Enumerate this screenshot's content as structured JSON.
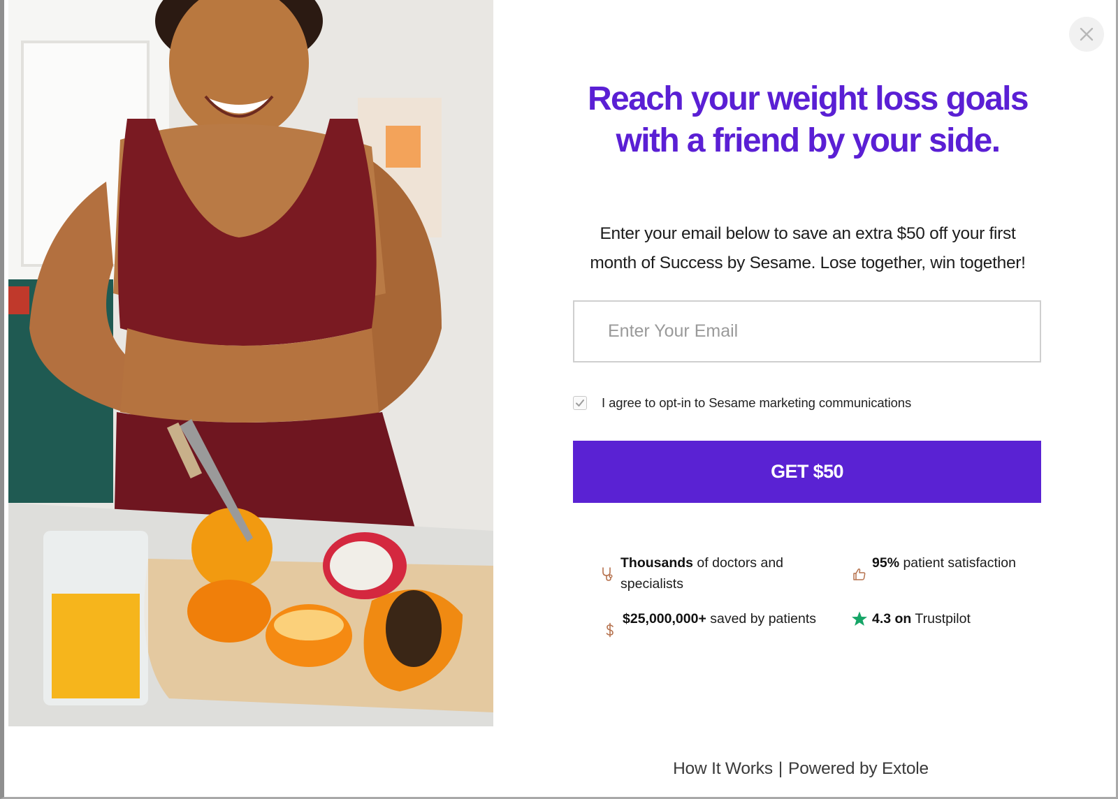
{
  "modal": {
    "headline_line1": "Reach your weight loss goals",
    "headline_line2": "with a friend by your side.",
    "subtext_line1": "Enter your email below to save an extra $50 off your first",
    "subtext_line2": "month of Success by Sesame. Lose together, win together!",
    "email": {
      "placeholder": "Enter Your Email",
      "value": ""
    },
    "optin": {
      "label": "I agree to opt-in to Sesame marketing communications",
      "checked": true
    },
    "cta_label": "GET $50",
    "close_icon": "close-icon",
    "accent_color": "#5a22d3",
    "headline_color": "#5a1fd4"
  },
  "trust": {
    "doctors": {
      "bold": "Thousands",
      "rest": " of doctors and specialists",
      "icon": "stethoscope-icon",
      "icon_color": "#b5714d"
    },
    "satisfaction": {
      "bold": "95%",
      "rest": " patient satisfaction",
      "icon": "thumbs-up-icon",
      "icon_color": "#b5714d"
    },
    "savings": {
      "bold": "$25,000,000+",
      "rest": " saved by patients",
      "icon": "dollar-icon",
      "icon_color": "#b5714d"
    },
    "trustpilot": {
      "bold": "4.3 on",
      "rest": " Trustpilot",
      "icon": "star-icon",
      "icon_color": "#16a567"
    }
  },
  "footer": {
    "how_it_works": "How It Works",
    "separator": "|",
    "powered_by": "Powered by Extole"
  },
  "hero_image": {
    "description_icon": "hero-photo"
  }
}
